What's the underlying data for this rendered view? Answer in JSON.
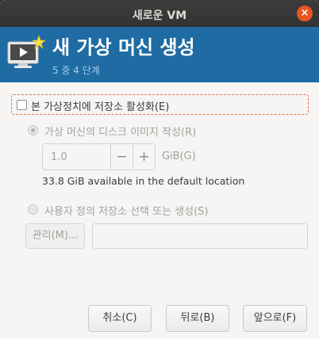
{
  "window": {
    "title": "새로운 VM",
    "close_glyph": "×"
  },
  "header": {
    "title": "새 가상 머신 생성",
    "step": "5 중 4 단계",
    "icon": "virtual-machine-new-icon",
    "accent_color": "#1f6ba4"
  },
  "storage": {
    "enable_label": "본 가상정치에 저장소 활성화(E)",
    "enable_checked": false,
    "create_disk_label": "가상 머신의 디스크 이미지 작성(R)",
    "size_value": "1.0",
    "size_minus": "−",
    "size_plus": "+",
    "size_unit": "GiB(G)",
    "available_text": "33.8 GiB available in the default location",
    "custom_label": "사용자 정의 저장소 선택 또는 생성(S)",
    "manage_label": "관리(M)...",
    "path_value": ""
  },
  "footer": {
    "cancel_label": "취소(C)",
    "back_label": "뒤로(B)",
    "forward_label": "앞으로(F)"
  }
}
